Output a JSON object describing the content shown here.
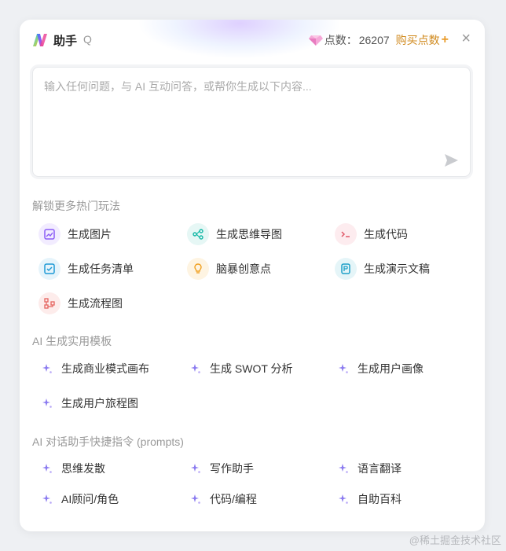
{
  "header": {
    "title": "助手",
    "q_hint": "Q",
    "credits_label": "点数：",
    "credits_value": "26207",
    "buy_label": "购买点数",
    "plus": "+",
    "close": "×"
  },
  "input": {
    "placeholder": "输入任何问题，与 AI 互动问答，或帮你生成以下内容..."
  },
  "sections": {
    "unlock": {
      "title": "解锁更多热门玩法",
      "items": [
        {
          "label": "生成图片",
          "icon": "image-icon",
          "color": "#8b5cf6",
          "bg": "#f2ecff"
        },
        {
          "label": "生成思维导图",
          "icon": "mindmap-icon",
          "color": "#14b8a6",
          "bg": "#e6f7f5"
        },
        {
          "label": "生成代码",
          "icon": "code-icon",
          "color": "#e05a6a",
          "bg": "#fdecef"
        },
        {
          "label": "生成任务清单",
          "icon": "checklist-icon",
          "color": "#1e9ad6",
          "bg": "#e6f4fb"
        },
        {
          "label": "脑暴创意点",
          "icon": "bulb-icon",
          "color": "#f0a020",
          "bg": "#fef4e2"
        },
        {
          "label": "生成演示文稿",
          "icon": "presentation-icon",
          "color": "#1ea0c8",
          "bg": "#e5f5f8"
        },
        {
          "label": "生成流程图",
          "icon": "flowchart-icon",
          "color": "#e5635e",
          "bg": "#fdeceb"
        }
      ]
    },
    "templates": {
      "title": "AI 生成实用模板",
      "items": [
        {
          "label": "生成商业模式画布"
        },
        {
          "label": "生成 SWOT 分析"
        },
        {
          "label": "生成用户画像"
        },
        {
          "label": "生成用户旅程图"
        }
      ]
    },
    "prompts": {
      "title": "AI 对话助手快捷指令 (prompts)",
      "items": [
        {
          "label": "思维发散"
        },
        {
          "label": "写作助手"
        },
        {
          "label": "语言翻译"
        },
        {
          "label": "AI顾问/角色"
        },
        {
          "label": "代码/编程"
        },
        {
          "label": "自助百科"
        }
      ]
    }
  },
  "watermark": "@稀土掘金技术社区"
}
